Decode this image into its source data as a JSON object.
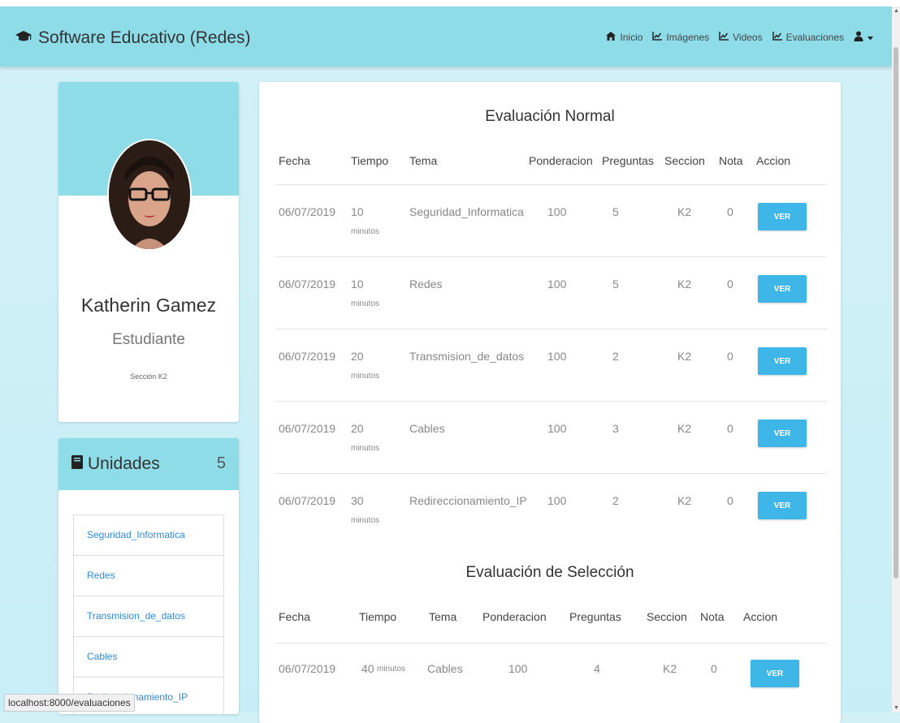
{
  "navbar": {
    "brand": "Software Educativo (Redes)",
    "links": [
      {
        "label": "Inicio",
        "icon": "home-icon"
      },
      {
        "label": "Imágenes",
        "icon": "chart-icon"
      },
      {
        "label": "Videos",
        "icon": "chart-icon"
      },
      {
        "label": "Evaluaciones",
        "icon": "chart-icon"
      }
    ],
    "user_icon": "user-icon"
  },
  "profile": {
    "name": "Katherin Gamez",
    "role": "Estudiante",
    "section": "Sección K2"
  },
  "units": {
    "title": "Unidades",
    "count": "5",
    "items": [
      "Seguridad_Informatica",
      "Redes",
      "Transmision_de_datos",
      "Cables",
      "Redireccionamiento_IP"
    ]
  },
  "normal_eval": {
    "title": "Evaluación Normal",
    "headers": [
      "Fecha",
      "Tiempo",
      "Tema",
      "Ponderacion",
      "Preguntas",
      "Seccion",
      "Nota",
      "Accion"
    ],
    "rows": [
      {
        "fecha": "06/07/2019",
        "tiempo": "10",
        "unidad": "minutos",
        "tema": "Seguridad_Informatica",
        "ponderacion": "100",
        "preguntas": "5",
        "seccion": "K2",
        "nota": "0",
        "accion": "VER"
      },
      {
        "fecha": "06/07/2019",
        "tiempo": "10",
        "unidad": "minutos",
        "tema": "Redes",
        "ponderacion": "100",
        "preguntas": "5",
        "seccion": "K2",
        "nota": "0",
        "accion": "VER"
      },
      {
        "fecha": "06/07/2019",
        "tiempo": "20",
        "unidad": "minutos",
        "tema": "Transmision_de_datos",
        "ponderacion": "100",
        "preguntas": "2",
        "seccion": "K2",
        "nota": "0",
        "accion": "VER"
      },
      {
        "fecha": "06/07/2019",
        "tiempo": "20",
        "unidad": "minutos",
        "tema": "Cables",
        "ponderacion": "100",
        "preguntas": "3",
        "seccion": "K2",
        "nota": "0",
        "accion": "VER"
      },
      {
        "fecha": "06/07/2019",
        "tiempo": "30",
        "unidad": "minutos",
        "tema": "Redireccionamiento_IP",
        "ponderacion": "100",
        "preguntas": "2",
        "seccion": "K2",
        "nota": "0",
        "accion": "VER"
      }
    ]
  },
  "selection_eval": {
    "title": "Evaluación de Selección",
    "headers": [
      "Fecha",
      "Tiempo",
      "Tema",
      "Ponderacion",
      "Preguntas",
      "Seccion",
      "Nota",
      "Accion"
    ],
    "rows": [
      {
        "fecha": "06/07/2019",
        "tiempo": "40",
        "unidad": "minutos",
        "tema": "Cables",
        "ponderacion": "100",
        "preguntas": "4",
        "seccion": "K2",
        "nota": "0",
        "accion": "VER"
      }
    ]
  },
  "status_bar": "localhost:8000/evaluaciones",
  "colors": {
    "navbar": "#8fdce9",
    "button": "#3eb7e8",
    "link": "#2e8bd8"
  }
}
